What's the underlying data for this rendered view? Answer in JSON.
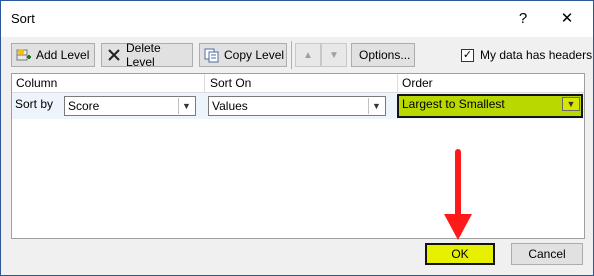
{
  "window": {
    "title": "Sort",
    "help_glyph": "?",
    "close_glyph": "✕"
  },
  "toolbar": {
    "add_level": "Add Level",
    "delete_level": "Delete Level",
    "copy_level": "Copy Level",
    "move_up_glyph": "▲",
    "move_down_glyph": "▼",
    "options": "Options...",
    "headers_checkbox_label": "My data has headers",
    "headers_checked": true
  },
  "grid": {
    "headers": [
      "Column",
      "Sort On",
      "Order"
    ],
    "row": {
      "label": "Sort by",
      "column": "Score",
      "sort_on": "Values",
      "order": "Largest to Smallest"
    }
  },
  "footer": {
    "ok": "OK",
    "cancel": "Cancel"
  },
  "colors": {
    "highlight_yellow": "#e7f000",
    "annotation_arrow": "#ff1a1a",
    "titlebar_border": "#2b579a"
  }
}
